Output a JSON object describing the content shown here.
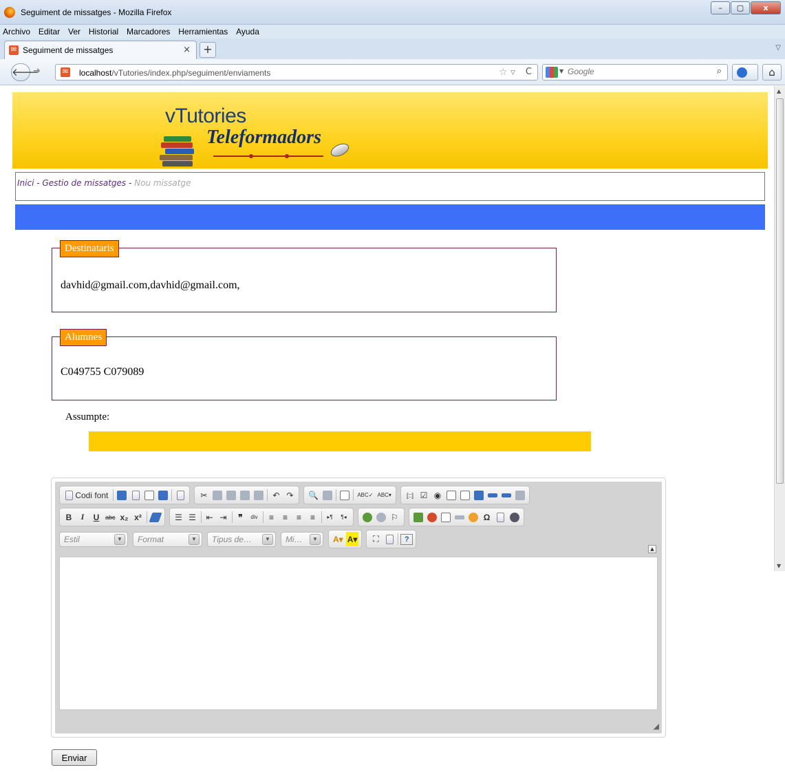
{
  "window": {
    "title": "Seguiment de missatges - Mozilla Firefox",
    "minimize": "–",
    "maximize": "▢",
    "close": "x"
  },
  "menu": [
    {
      "label": "Archivo"
    },
    {
      "label": "Editar"
    },
    {
      "label": "Ver"
    },
    {
      "label": "Historial"
    },
    {
      "label": "Marcadores"
    },
    {
      "label": "Herramientas"
    },
    {
      "label": "Ayuda"
    }
  ],
  "tab": {
    "title": "Seguiment de missatges",
    "close": "×",
    "new_tab": "+"
  },
  "nav": {
    "url_host": "localhost",
    "url_path": "/vTutories/index.php/seguiment/enviaments",
    "search_placeholder": "Google"
  },
  "banner": {
    "title": "vTutories",
    "subtitle": "Teleformadors"
  },
  "breadcrumb": {
    "home": "Inici",
    "sep": " - ",
    "manage": "Gestio de missatges",
    "current": "Nou missatge"
  },
  "recipients": {
    "legend": "Destinataris",
    "value": "davhid@gmail.com,davhid@gmail.com,"
  },
  "students": {
    "legend": "Alumnes",
    "value": "C049755 C079089"
  },
  "subject": {
    "label": "Assumpte:",
    "value": ""
  },
  "editor": {
    "source_label": "Codi font",
    "combos": {
      "style": "Estil",
      "format": "Format",
      "font": "Tipus de…",
      "size": "Mi…"
    }
  },
  "send_label": "Enviar",
  "colors": {
    "banner": "#ffd321",
    "bluebar": "#3d6ff9",
    "legend_bg": "#ff9a00",
    "subject_bg": "#ffcc00",
    "border": "#7b1f3c"
  }
}
